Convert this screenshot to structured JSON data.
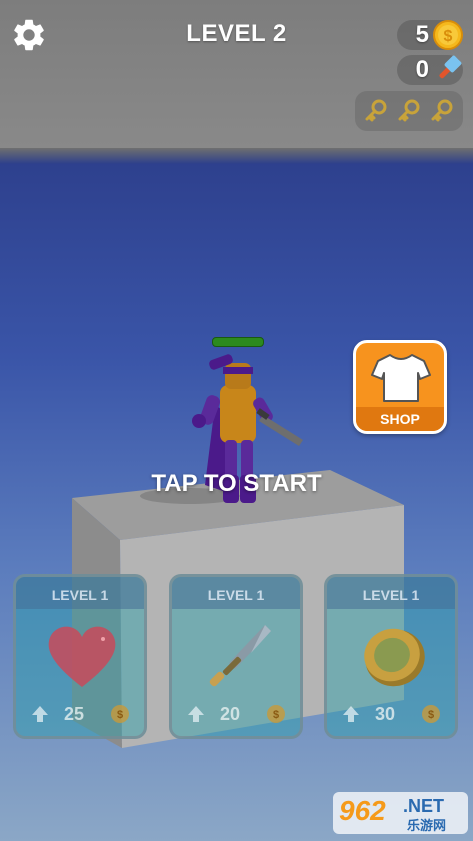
{
  "hud": {
    "level_title": "LEVEL 2",
    "coins": "5",
    "hammers": "0",
    "keys_collected": 0,
    "keys_total": 3
  },
  "shop": {
    "label": "SHOP"
  },
  "prompt": {
    "tap_to_start": "TAP TO START"
  },
  "upgrades": [
    {
      "level_label": "LEVEL 1",
      "icon": "heart-icon",
      "price": "25"
    },
    {
      "level_label": "LEVEL 1",
      "icon": "sword-icon",
      "price": "20"
    },
    {
      "level_label": "LEVEL 1",
      "icon": "coin-stack-icon",
      "price": "30"
    }
  ],
  "watermark": {
    "brand": "962",
    "suffix": ".NET",
    "caption": "乐游网"
  },
  "colors": {
    "shop_orange": "#f7931e",
    "health_green": "#2c8a1e",
    "coin_gold": "#f5b81c"
  }
}
